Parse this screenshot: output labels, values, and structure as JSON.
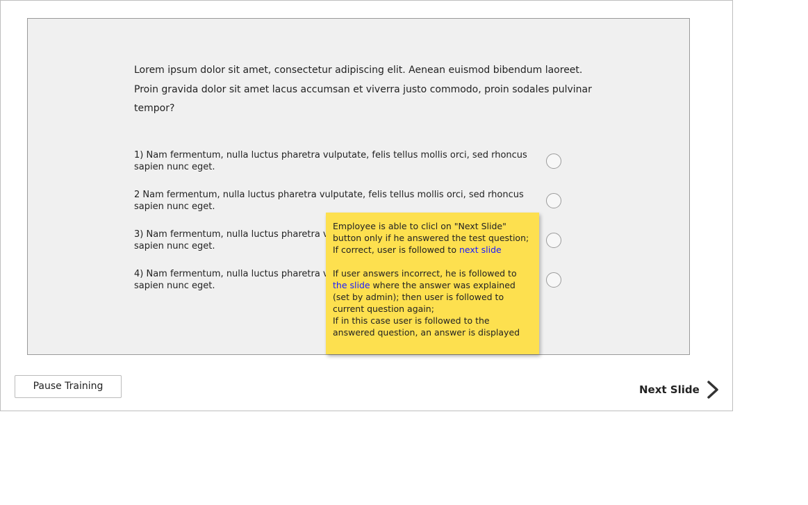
{
  "question": {
    "lines": [
      "Lorem ipsum dolor sit amet, consectetur adipiscing elit. Aenean euismod bibendum laoreet.",
      "Proin gravida dolor sit amet lacus accumsan et viverra justo commodo, proin sodales pulvinar",
      "tempor?"
    ]
  },
  "answers": [
    {
      "line1": "1) Nam fermentum, nulla luctus pharetra vulputate, felis tellus mollis orci, sed rhoncus",
      "line2": "sapien nunc eget.",
      "selected": false
    },
    {
      "line1": "2 Nam fermentum, nulla luctus pharetra vulputate, felis tellus mollis orci, sed rhoncus",
      "line2": "sapien nunc eget.",
      "selected": false
    },
    {
      "line1": "3) Nam fermentum, nulla luctus pharetra vulputate, felis tellus mollis orci, sed rhoncus",
      "line2": "sapien nunc eget.",
      "selected": false
    },
    {
      "line1": "4) Nam fermentum, nulla luctus pharetra vulputate, felis tellus mollis orci, sed rhoncus",
      "line2": "sapien nunc eget.",
      "selected": false
    }
  ],
  "note": {
    "p1_line1": "Employee is able to clicl on \"Next Slide\"",
    "p1_line2": "button only if he answered the test question;",
    "p1_line3_text": "If correct, user is followed to ",
    "p1_line3_link": "next slide",
    "p2_line1": "If user answers incorrect, he is followed to",
    "p2_line2_link": "the slide",
    "p2_line2_text": " where the answer was explained",
    "p2_line3": "(set by admin); then user is followed to",
    "p2_line4": "current question again;",
    "p2_line5": "If in this case user is followed to the",
    "p2_line6": "answered question, an answer is displayed",
    "background_color": "#fde04f",
    "link_color": "#1a1aff"
  },
  "footer": {
    "pause_label": "Pause Training",
    "next_label": "Next Slide",
    "next_icon": "chevron-right-icon"
  }
}
